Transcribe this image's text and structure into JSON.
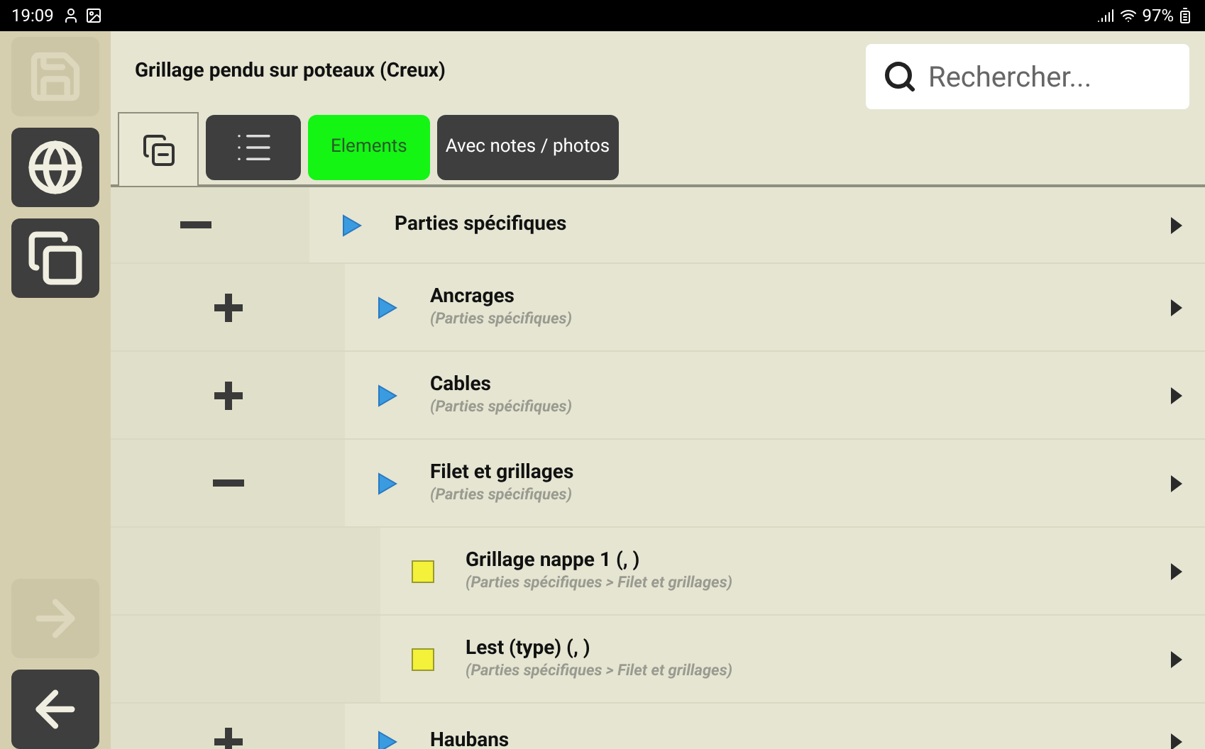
{
  "status_bar": {
    "time": "19:09",
    "battery": "97%"
  },
  "sidebar": [
    {
      "kind": "save",
      "disabled": true
    },
    {
      "kind": "globe",
      "disabled": false
    },
    {
      "kind": "copy",
      "disabled": false
    },
    {
      "kind": "spacer"
    },
    {
      "kind": "forward",
      "disabled": true
    },
    {
      "kind": "back",
      "disabled": false
    }
  ],
  "title": "Grillage pendu sur poteaux (Creux)",
  "search": {
    "placeholder": "Rechercher..."
  },
  "filters": [
    {
      "label": "Elements",
      "selected": true
    },
    {
      "label": "Avec notes / photos",
      "selected": false
    }
  ],
  "tree": [
    {
      "label": "Parties spécifiques",
      "kind": "group",
      "expanded": true,
      "children": [
        {
          "label": "Ancrages",
          "path": "(Parties spécifiques)",
          "kind": "group",
          "expanded": false
        },
        {
          "label": "Cables",
          "path": "(Parties spécifiques)",
          "kind": "group",
          "expanded": false
        },
        {
          "label": "Filet et grillages",
          "path": "(Parties spécifiques)",
          "kind": "group",
          "expanded": true,
          "children": [
            {
              "label": "Grillage nappe 1 (, )",
              "path": "(Parties spécifiques > Filet et grillages)",
              "kind": "leaf"
            },
            {
              "label": "Lest (type) (, )",
              "path": "(Parties spécifiques > Filet et grillages)",
              "kind": "leaf"
            }
          ]
        },
        {
          "label": "Haubans",
          "kind": "group",
          "expanded": false
        }
      ]
    }
  ]
}
